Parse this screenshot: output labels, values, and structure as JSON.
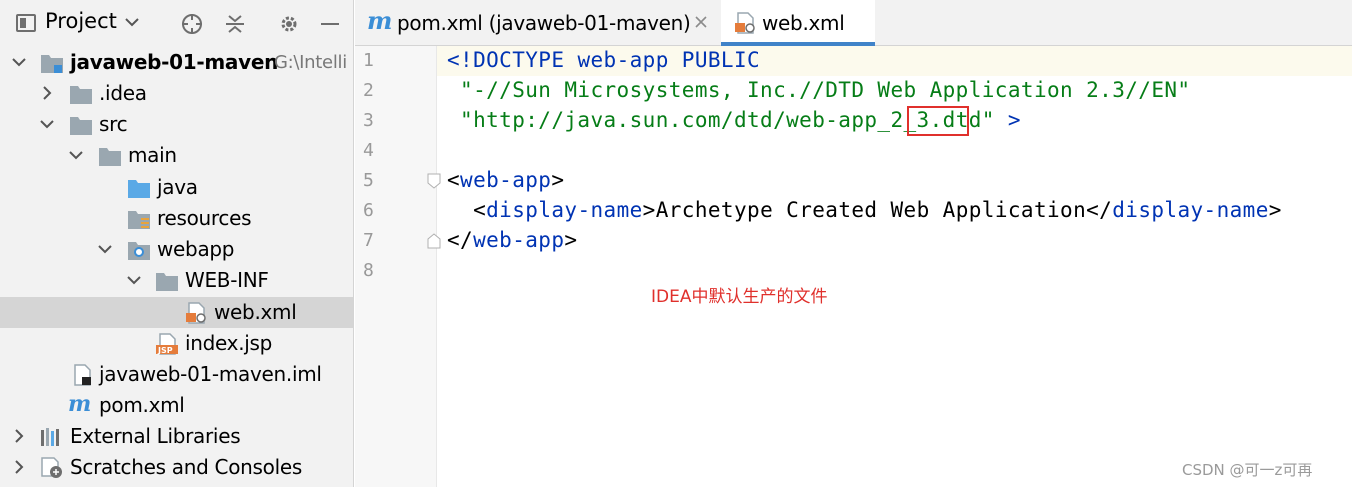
{
  "project_panel": {
    "title": "Project",
    "tree": [
      {
        "label": "javaweb-01-maven",
        "path": "G:\\Intelli",
        "icon": "module-folder-icon",
        "expanded": true,
        "bold": true
      },
      {
        "label": ".idea",
        "icon": "folder-icon",
        "expanded": false
      },
      {
        "label": "src",
        "icon": "folder-icon",
        "expanded": true
      },
      {
        "label": "main",
        "icon": "folder-icon",
        "expanded": true
      },
      {
        "label": "java",
        "icon": "source-folder-icon"
      },
      {
        "label": "resources",
        "icon": "resources-folder-icon"
      },
      {
        "label": "webapp",
        "icon": "web-folder-icon",
        "expanded": true
      },
      {
        "label": "WEB-INF",
        "icon": "folder-icon",
        "expanded": true
      },
      {
        "label": "web.xml",
        "icon": "xml-file-icon",
        "selected": true
      },
      {
        "label": "index.jsp",
        "icon": "jsp-file-icon"
      },
      {
        "label": "javaweb-01-maven.iml",
        "icon": "iml-file-icon"
      },
      {
        "label": "pom.xml",
        "icon": "maven-icon"
      },
      {
        "label": "External Libraries",
        "icon": "libraries-icon",
        "expanded": false
      },
      {
        "label": "Scratches and Consoles",
        "icon": "scratches-icon",
        "expanded": false
      }
    ]
  },
  "tabs": [
    {
      "label": "pom.xml (javaweb-01-maven)",
      "icon": "maven-icon",
      "active": false
    },
    {
      "label": "web.xml",
      "icon": "xml-file-icon",
      "active": true
    }
  ],
  "editor": {
    "line_numbers": [
      "1",
      "2",
      "3",
      "4",
      "5",
      "6",
      "7",
      "8"
    ],
    "line1": {
      "t1": "<!DOCTYPE ",
      "t2": "web-app",
      "t3": " PUBLIC"
    },
    "line2": {
      "t1": " \"-//Sun Microsystems, Inc.//DTD Web Application 2.3//EN\""
    },
    "line3": {
      "t1": " \"http://java.sun.com/dtd/web-app",
      "t2": "_2_3",
      "t3": ".dtd\"",
      "t4": " >"
    },
    "line5": {
      "t1": "<",
      "t2": "web-app",
      "t3": ">"
    },
    "line6": {
      "t1": "  <",
      "t2": "display-name",
      "t3": ">",
      "t4": "Archetype Created Web Application",
      "t5": "</",
      "t6": "display-name",
      "t7": ">"
    },
    "line7": {
      "t1": "</",
      "t2": "web-app",
      "t3": ">"
    }
  },
  "annotation": "IDEA中默认生产的文件",
  "watermark": "CSDN @可一z可再",
  "colors": {
    "accent": "#4083c9",
    "annotation": "#e0302c",
    "selection": "#d5d5d5"
  }
}
